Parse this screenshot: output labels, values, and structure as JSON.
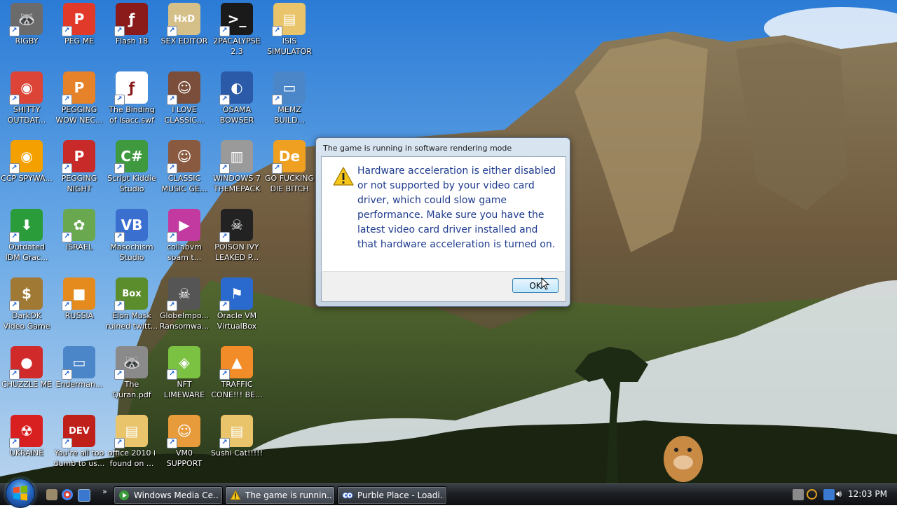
{
  "desktop_icons": [
    {
      "label": "RIGBY",
      "icon": "raccoon-icon",
      "bg": "#6b6b6b"
    },
    {
      "label": "SHITTY OUTDAT...",
      "icon": "chrome-icon",
      "bg": "#db4437"
    },
    {
      "label": "CCP SPYWA...",
      "icon": "chromium-icon",
      "bg": "#f4a000"
    },
    {
      "label": "Outdated IDM Grac...",
      "icon": "download-manager-icon",
      "bg": "#2a9d3a"
    },
    {
      "label": "DarkOK Video Game",
      "icon": "money-bag-icon",
      "bg": "#a07a35"
    },
    {
      "label": "CHUZZLE ME",
      "icon": "chuzzle-icon",
      "bg": "#d12a2a"
    },
    {
      "label": "UKRAINE",
      "icon": "radiation-icon",
      "bg": "#d92020"
    },
    {
      "label": "PEG ME",
      "icon": "peggle-icon",
      "bg": "#e23a2a"
    },
    {
      "label": "PEGGING WOW NEC...",
      "icon": "peggle-icon",
      "bg": "#e6822a"
    },
    {
      "label": "PEGGING NIGHT",
      "icon": "peggle-icon",
      "bg": "#c82a2a"
    },
    {
      "label": "ISRAEL",
      "icon": "flower-icon",
      "bg": "#6aa84f"
    },
    {
      "label": "RUSSIA",
      "icon": "cube-icon",
      "bg": "#e58a1c"
    },
    {
      "label": "Enderman...",
      "icon": "window-icon",
      "bg": "#4a86c8"
    },
    {
      "label": "You're all too dumb to us...",
      "icon": "dev-cpp-icon",
      "bg": "#c0201a"
    },
    {
      "label": "Flash 18",
      "icon": "flash-icon",
      "bg": "#8b1a1a"
    },
    {
      "label": "The Binding of Isacc.swf",
      "icon": "flash-file-icon",
      "bg": "#ffffff"
    },
    {
      "label": "Script Kiddie Studio",
      "icon": "csharp-icon",
      "bg": "#3f9a3f"
    },
    {
      "label": "Masochism Studio",
      "icon": "vb-icon",
      "bg": "#3a6ecf"
    },
    {
      "label": "Elon Musk ruined twitt...",
      "icon": "bonzi-box-icon",
      "bg": "#5c8d2c"
    },
    {
      "label": "The Quran.pdf",
      "icon": "raccoon-icon",
      "bg": "#8a8a8a"
    },
    {
      "label": "office 2010 i found on ...",
      "icon": "folder-icon",
      "bg": "#e9c46a"
    },
    {
      "label": "SEX EDITOR",
      "icon": "hxd-icon",
      "bg": "#d6c08a"
    },
    {
      "label": "I LOVE CLASSIC...",
      "icon": "portrait-icon",
      "bg": "#7a4e3a"
    },
    {
      "label": "CLASSIC MUSIC GE...",
      "icon": "portrait-icon",
      "bg": "#8a5a40"
    },
    {
      "label": "collabvm spam t...",
      "icon": "media-icon",
      "bg": "#c23aa0"
    },
    {
      "label": "GlobeImpo... Ransomwa...",
      "icon": "skull-icon",
      "bg": "#555555"
    },
    {
      "label": "NFT LIMEWARE",
      "icon": "limewire-icon",
      "bg": "#7cc242"
    },
    {
      "label": "VM0 SUPPORT",
      "icon": "support-icon",
      "bg": "#e89b3a"
    },
    {
      "label": "2PACALYPSE 2.3",
      "icon": "terminal-icon",
      "bg": "#1a1a1a"
    },
    {
      "label": "OSAMA BOWSER",
      "icon": "obama-logo-icon",
      "bg": "#2a5aa8"
    },
    {
      "label": "WINDOWS 7 THEMEPACK",
      "icon": "computer-icon",
      "bg": "#9a9a9a"
    },
    {
      "label": "POISON IVY LEAKED P...",
      "icon": "skull-icon",
      "bg": "#222222"
    },
    {
      "label": "Oracle VM VirtualBox",
      "icon": "windows-flag-icon",
      "bg": "#2a6acf"
    },
    {
      "label": "TRAFFIC CONE!!! BE...",
      "icon": "traffic-cone-icon",
      "bg": "#f28c28"
    },
    {
      "label": "Sushi Cat!!!!!",
      "icon": "folder-icon",
      "bg": "#e9c46a"
    },
    {
      "label": "ISIS SIMULATOR",
      "icon": "folder-icon",
      "bg": "#e9c46a"
    },
    {
      "label": "MEMZ BUILD...",
      "icon": "window-icon",
      "bg": "#4a86c8"
    },
    {
      "label": "GO FUCKING DIE BITCH",
      "icon": "de-icon",
      "bg": "#f0a020"
    }
  ],
  "dialog": {
    "title": "The game is running in software rendering mode",
    "message": "Hardware acceleration is either disabled or not supported by your video card driver, which could slow game performance. Make sure you have the latest video card driver installed and that hardware acceleration is turned on.",
    "ok_label": "OK"
  },
  "taskbar": {
    "quick_launch": [
      "desktop-icon",
      "chrome-quicklaunch-icon",
      "window-switch-icon"
    ],
    "tasks": [
      {
        "label": "Windows Media Ce...",
        "icon": "media-center-icon"
      },
      {
        "label": "The game is runnin...",
        "icon": "warning-icon"
      },
      {
        "label": "Purble Place - Loadi...",
        "icon": "purble-place-icon"
      }
    ],
    "clock": "12:03 PM"
  },
  "colors": {
    "accent": "#1f3c8f",
    "taskbar": "#1c1f24"
  }
}
